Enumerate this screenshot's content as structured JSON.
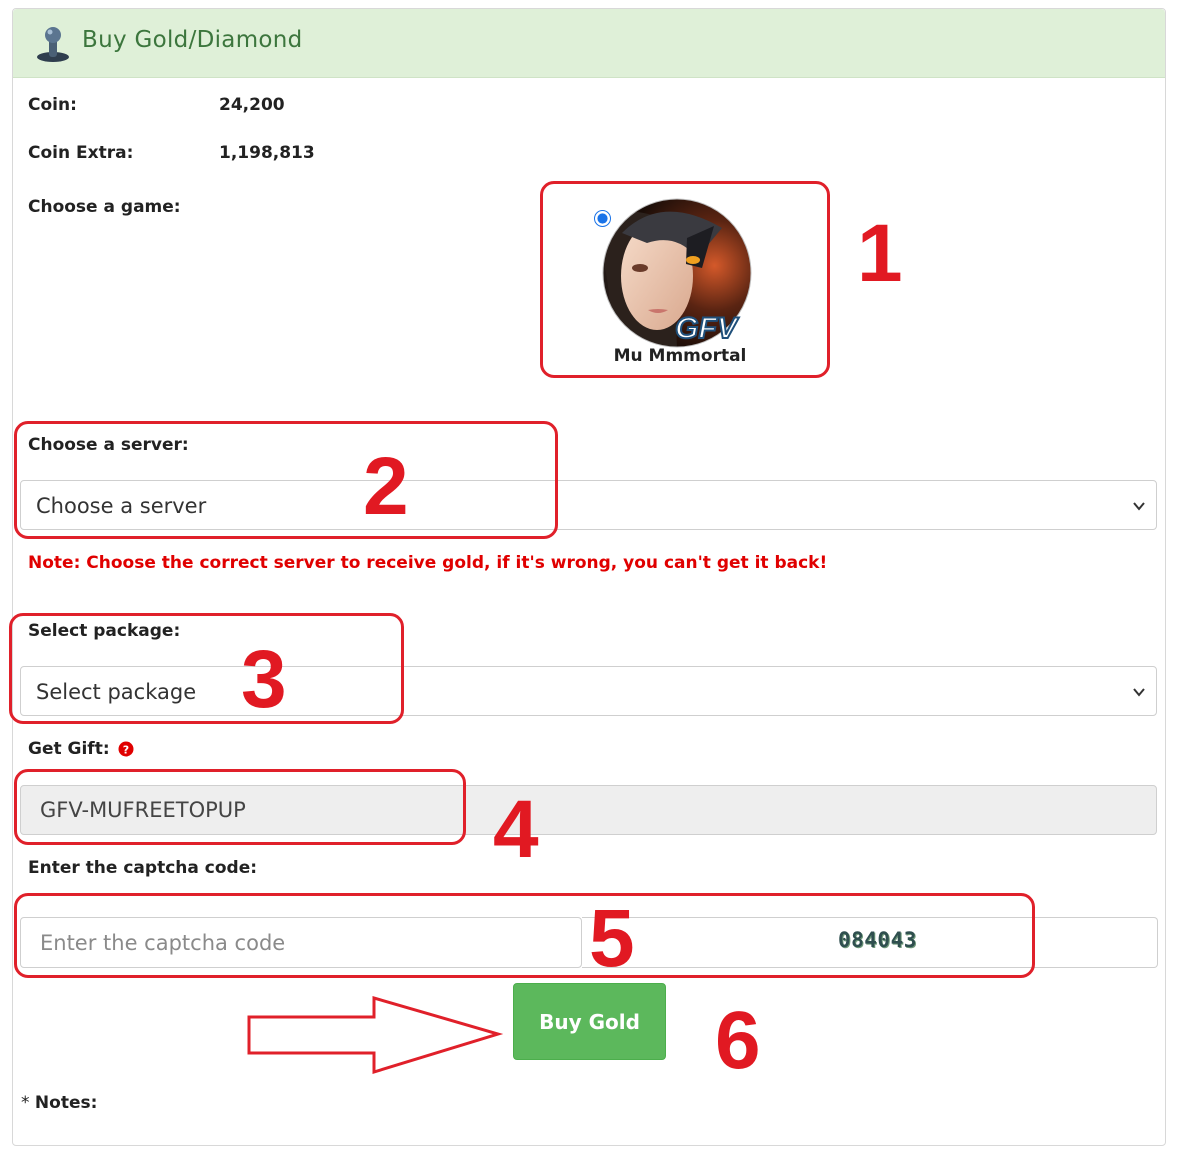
{
  "header": {
    "title": "Buy Gold/Diamond",
    "icon": "joystick-icon"
  },
  "account": {
    "coin_label": "Coin:",
    "coin_value": "24,200",
    "coin_extra_label": "Coin Extra:",
    "coin_extra_value": "1,198,813"
  },
  "game": {
    "label": "Choose a game:",
    "options": [
      {
        "name": "Mu Mmmortal",
        "selected": true,
        "logo_text": "GFV"
      }
    ]
  },
  "server": {
    "label": "Choose a server:",
    "selected": "Choose a server",
    "note": "Note: Choose the correct server to receive gold, if it's wrong, you can't get it back!"
  },
  "package": {
    "label": "Select package:",
    "selected": "Select package"
  },
  "gift": {
    "label": "Get Gift:",
    "value": "GFV-MUFREETOPUP",
    "help_icon": "question-circle-icon"
  },
  "captcha": {
    "label": "Enter the captcha code:",
    "placeholder": "Enter the captcha code",
    "code": "084043"
  },
  "submit": {
    "label": "Buy Gold"
  },
  "notes": {
    "star": "*",
    "label": "Notes:"
  },
  "annotations": [
    "1",
    "2",
    "3",
    "4",
    "5",
    "6"
  ],
  "colors": {
    "header_bg": "#dff0d8",
    "header_text": "#3c763d",
    "button": "#5cb85c",
    "note_red": "#e00000",
    "annotation_red": "#e0202a"
  }
}
